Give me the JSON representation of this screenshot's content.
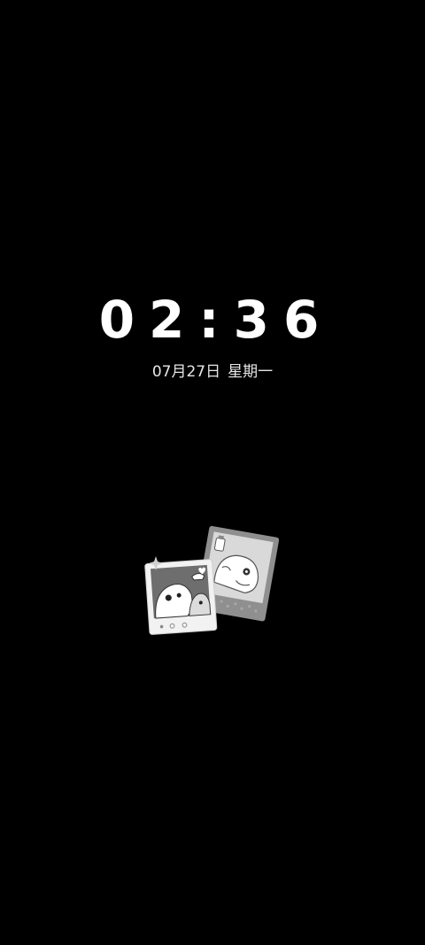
{
  "lockscreen": {
    "time": "02:36",
    "date": "07月27日",
    "weekday": "星期一"
  },
  "colors": {
    "background": "#000000",
    "text": "#ffffff",
    "sticker_light": "#f2f2f2",
    "sticker_mid": "#9a9a9a"
  },
  "icons": {
    "sticker": "polaroid-photos-sticker-icon"
  }
}
